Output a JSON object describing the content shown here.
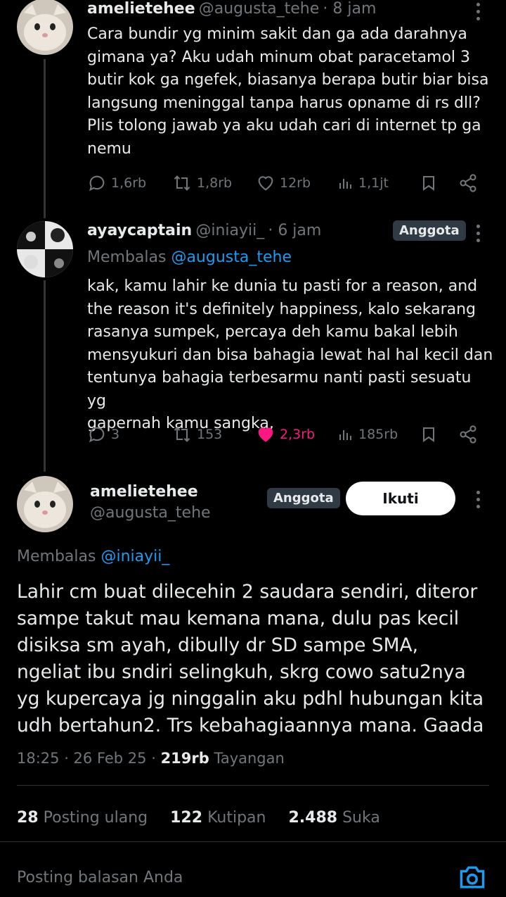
{
  "tweet1": {
    "name": "amelietehee",
    "handle": "@augusta_tehe",
    "time": "· 8 jam",
    "lines": [
      "Cara bundir yg minim sakit dan ga ada darahnya",
      "gimana ya? Aku udah minum obat paracetamol 3",
      "butir kok ga ngefek, biasanya berapa butir biar bisa",
      "langsung meninggal tanpa harus opname di rs dll?",
      "Plis tolong jawab ya aku udah cari di internet tp ga",
      "nemu"
    ],
    "replies": "1,6rb",
    "reposts": "1,8rb",
    "likes": "12rb",
    "views": "1,1jt"
  },
  "tweet2": {
    "name": "ayaycaptain",
    "handle": "@iniayii_",
    "time": "· 6 jam",
    "badge": "Anggota",
    "reply_prefix": "Membalas",
    "reply_to": "@augusta_tehe",
    "lines": [
      "kak, kamu lahir ke dunia tu pasti for a reason, and",
      "the reason it's definitely happiness, kalo sekarang",
      "rasanya sumpek, percaya deh kamu bakal lebih",
      "mensyukuri dan bisa bahagia lewat hal hal kecil dan",
      "tentunya bahagia terbesarmu nanti pasti sesuatu yg",
      "gapernah kamu sangka,"
    ],
    "replies": "3",
    "reposts": "153",
    "likes": "2,3rb",
    "views": "185rb",
    "like_color": "#f91880"
  },
  "main": {
    "name": "amelietehee",
    "handle": "@augusta_tehe",
    "badge": "Anggota",
    "follow_label": "Ikuti",
    "reply_prefix": "Membalas",
    "reply_to": "@iniayii_",
    "lines": [
      "Lahir cm buat dilecehin 2 saudara sendiri, diteror",
      "sampe takut mau kemana mana, dulu pas kecil",
      "disiksa sm ayah, dibully dr SD sampe SMA,",
      "ngeliat ibu sndiri selingkuh, skrg cowo satu2nya",
      "yg kupercaya jg ninggalin aku pdhl hubungan kita",
      "udh bertahun2. Trs kebahagiaannya mana. Gaada"
    ],
    "time": "18:25 · 26 Feb 25 ·",
    "views_count": "219rb",
    "views_label": "Tayangan",
    "reposts_count": "28",
    "reposts_label": "Posting ulang",
    "quotes_count": "122",
    "quotes_label": "Kutipan",
    "likes_count": "2.488",
    "likes_label": "Suka"
  },
  "reply_bar": {
    "placeholder": "Posting balasan Anda",
    "accent": "#1d9bf0"
  },
  "icons": [
    "reply-icon",
    "repost-icon",
    "like-icon",
    "views-icon",
    "bookmark-icon",
    "share-icon",
    "more-icon",
    "camera-icon"
  ]
}
